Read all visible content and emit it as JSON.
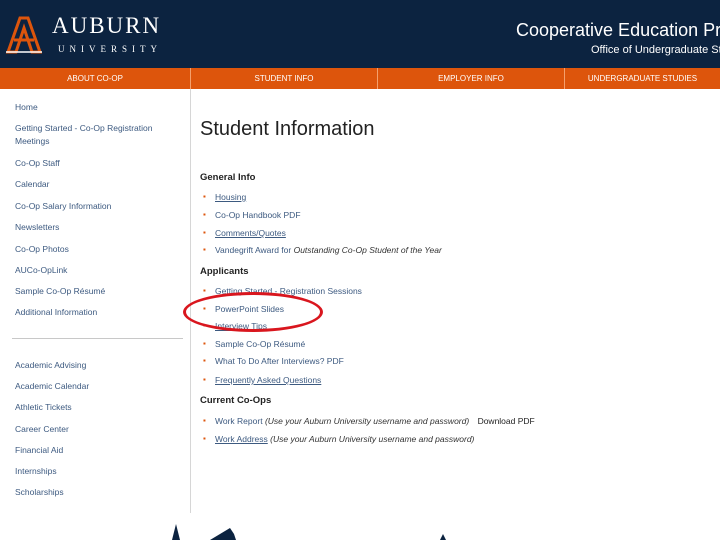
{
  "header": {
    "logo_name": "AUBURN",
    "logo_sub": "UNIVERSITY",
    "title": "Cooperative Education Progr",
    "subtitle": "Office of Undergraduate Stu"
  },
  "nav": [
    "ABOUT CO-OP",
    "STUDENT INFO",
    "EMPLOYER INFO",
    "UNDERGRADUATE STUDIES"
  ],
  "sidebar": {
    "primary": [
      "Home",
      "Getting Started - Co-Op Registration Meetings",
      "Co-Op Staff",
      "Calendar",
      "Co-Op Salary Information",
      "Newsletters",
      "Co-Op Photos",
      "AUCo-OpLink",
      "Sample Co-Op Résumé",
      "Additional Information"
    ],
    "secondary": [
      "Academic Advising",
      "Academic Calendar",
      "Athletic Tickets",
      "Career Center",
      "Financial Aid",
      "Internships",
      "Scholarships"
    ]
  },
  "main": {
    "title": "Student Information",
    "general": {
      "heading": "General Info",
      "housing": "Housing",
      "handbook": "Co-Op Handbook PDF",
      "comments": "Comments/Quotes",
      "award_a": "Vandegrift Award for ",
      "award_b": "Outstanding Co-Op Student of the Year"
    },
    "applicants": {
      "heading": "Applicants",
      "getting_started": "Getting Started - Registration Sessions",
      "powerpoint": "PowerPoint Slides",
      "interview": "Interview Tips",
      "resume": "Sample Co-Op Résumé",
      "after": "What To Do After Interviews? PDF",
      "faq": "Frequently Asked Questions"
    },
    "current": {
      "heading": "Current Co-Ops",
      "work_report": "Work Report",
      "work_report_note": "(Use your Auburn University username and password)",
      "download": "Download PDF",
      "work_address": "Work Address",
      "work_address_note": "(Use your Auburn University username and password)"
    }
  },
  "colors": {
    "navy": "#0c2340",
    "orange": "#dd550c",
    "highlight": "#d9161e"
  }
}
